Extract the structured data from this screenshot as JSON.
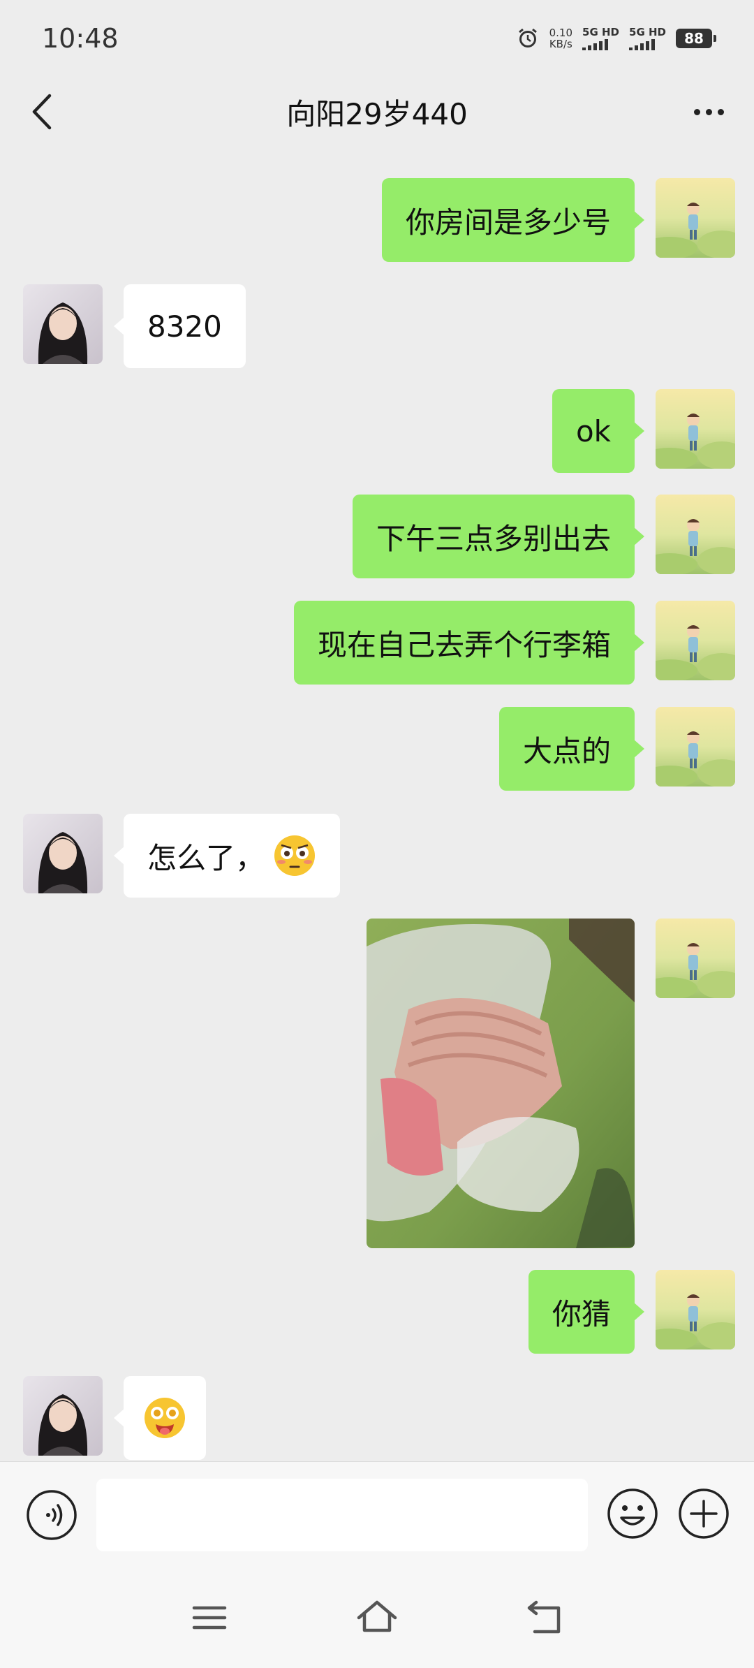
{
  "status_bar": {
    "time": "10:48",
    "net_speed_value": "0.10",
    "net_speed_unit": "KB/s",
    "sim1_label": "5G HD",
    "sim2_label": "5G HD",
    "battery": "88"
  },
  "header": {
    "title": "向阳29岁440"
  },
  "messages": [
    {
      "side": "right",
      "type": "text",
      "text": "你房间是多少号"
    },
    {
      "side": "left",
      "type": "text",
      "text": "8320"
    },
    {
      "side": "right",
      "type": "text",
      "text": "ok"
    },
    {
      "side": "right",
      "type": "text",
      "text": "下午三点多别出去"
    },
    {
      "side": "right",
      "type": "text",
      "text": "现在自己去弄个行李箱"
    },
    {
      "side": "right",
      "type": "text",
      "text": "大点的"
    },
    {
      "side": "left",
      "type": "text_emoji",
      "text": "怎么了，",
      "emoji": "flushed-face-icon"
    },
    {
      "side": "right",
      "type": "image",
      "content": "cash-in-plastic-bag-photo"
    },
    {
      "side": "right",
      "type": "text",
      "text": "你猜"
    },
    {
      "side": "left",
      "type": "emoji",
      "emoji": "starstruck-tongue-face-icon"
    }
  ],
  "input_bar": {
    "value": "",
    "voice_icon": "voice-icon",
    "emoji_icon": "smiley-icon",
    "plus_icon": "plus-icon"
  },
  "nav_bar": {
    "menu_icon": "menu-icon",
    "home_icon": "home-icon",
    "back_icon": "back-icon"
  },
  "colors": {
    "background": "#ededed",
    "sent_bubble": "#95ec69",
    "received_bubble": "#ffffff"
  }
}
